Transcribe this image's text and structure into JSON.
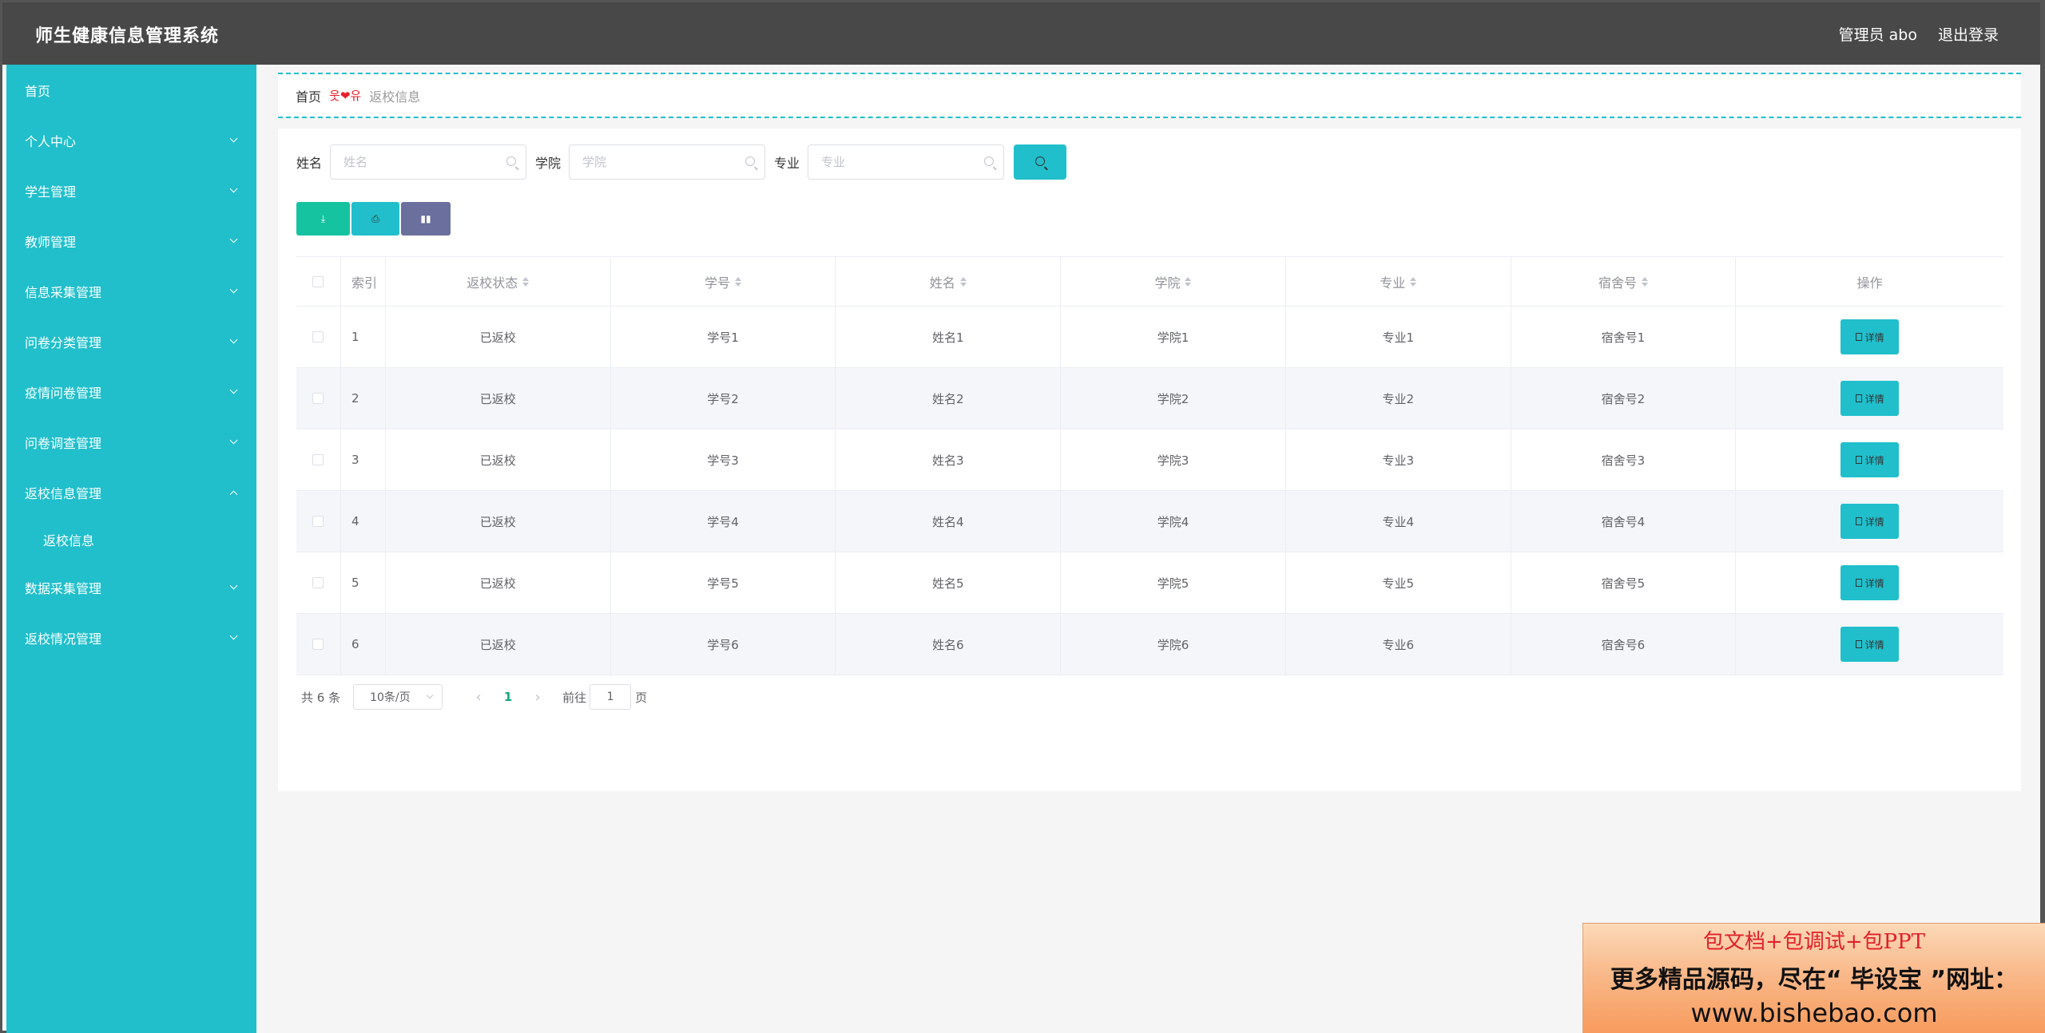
{
  "header": {
    "title": "师生健康信息管理系统",
    "user": "管理员 abo",
    "logout": "退出登录"
  },
  "sidebar": {
    "items": [
      {
        "label": "首页",
        "expandable": false
      },
      {
        "label": "个人中心",
        "expandable": true
      },
      {
        "label": "学生管理",
        "expandable": true
      },
      {
        "label": "教师管理",
        "expandable": true
      },
      {
        "label": "信息采集管理",
        "expandable": true
      },
      {
        "label": "问卷分类管理",
        "expandable": true
      },
      {
        "label": "疫情问卷管理",
        "expandable": true
      },
      {
        "label": "问卷调查管理",
        "expandable": true
      },
      {
        "label": "返校信息管理",
        "expandable": true,
        "expanded": true
      },
      {
        "label": "数据采集管理",
        "expandable": true
      },
      {
        "label": "返校情况管理",
        "expandable": true
      }
    ],
    "submenu": {
      "label": "返校信息"
    }
  },
  "breadcrumb": {
    "home": "首页",
    "separator": "웃❤유",
    "current": "返校信息"
  },
  "search": {
    "name_label": "姓名",
    "name_placeholder": "姓名",
    "college_label": "学院",
    "college_placeholder": "学院",
    "major_label": "专业",
    "major_placeholder": "专业"
  },
  "table": {
    "headers": [
      "索引",
      "返校状态",
      "学号",
      "姓名",
      "学院",
      "专业",
      "宿舍号",
      "操作"
    ],
    "detail_label": "详情",
    "rows": [
      {
        "idx": "1",
        "status": "已返校",
        "sid": "学号1",
        "name": "姓名1",
        "college": "学院1",
        "major": "专业1",
        "dorm": "宿舍号1"
      },
      {
        "idx": "2",
        "status": "已返校",
        "sid": "学号2",
        "name": "姓名2",
        "college": "学院2",
        "major": "专业2",
        "dorm": "宿舍号2"
      },
      {
        "idx": "3",
        "status": "已返校",
        "sid": "学号3",
        "name": "姓名3",
        "college": "学院3",
        "major": "专业3",
        "dorm": "宿舍号3"
      },
      {
        "idx": "4",
        "status": "已返校",
        "sid": "学号4",
        "name": "姓名4",
        "college": "学院4",
        "major": "专业4",
        "dorm": "宿舍号4"
      },
      {
        "idx": "5",
        "status": "已返校",
        "sid": "学号5",
        "name": "姓名5",
        "college": "学院5",
        "major": "专业5",
        "dorm": "宿舍号5"
      },
      {
        "idx": "6",
        "status": "已返校",
        "sid": "学号6",
        "name": "姓名6",
        "college": "学院6",
        "major": "专业6",
        "dorm": "宿舍号6"
      }
    ]
  },
  "pagination": {
    "total": "共 6 条",
    "page_size": "10条/页",
    "current_page": "1",
    "goto_label": "前往",
    "goto_value": "1",
    "page_suffix": "页"
  },
  "promo": {
    "line1": "包文档+包调试+包PPT",
    "line2": "更多精品源码，尽在“ 毕设宝 ”网址：",
    "line3": "www.bishebao.com"
  },
  "colors": {
    "sidebar": "#20bfcb",
    "header": "#484848",
    "accent": "#20bfcb",
    "export_button": "#16c3a0",
    "chart_button": "#6b6f9e"
  }
}
